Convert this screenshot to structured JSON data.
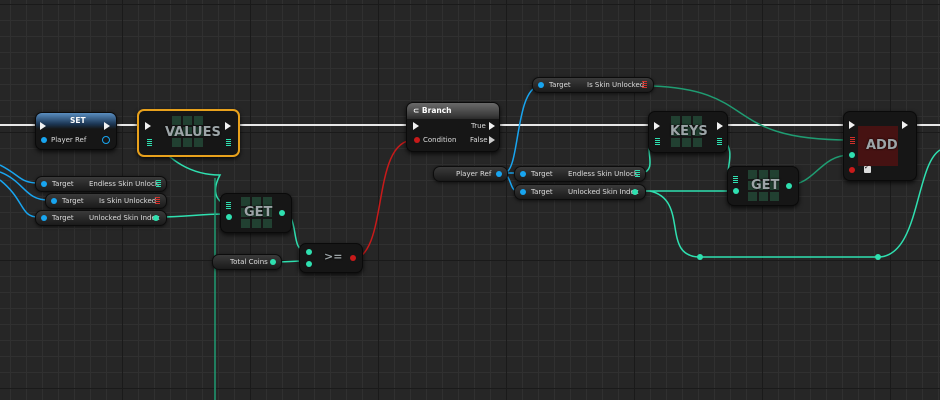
{
  "nodes": {
    "set": {
      "title": "SET",
      "pin_player_ref": "Player Ref"
    },
    "values": {
      "title": "VALUES"
    },
    "targets_left": [
      {
        "target": "Target",
        "value": "Endless Skin Unlock"
      },
      {
        "target": "Target",
        "value": "Is Skin Unlocked"
      },
      {
        "target": "Target",
        "value": "Unlocked Skin Index"
      }
    ],
    "get_left": {
      "title": "GET"
    },
    "total_coins": {
      "label": "Total Coins"
    },
    "compare": {
      "title": ">="
    },
    "branch": {
      "title": "Branch",
      "condition": "Condition",
      "true_label": "True",
      "false_label": "False"
    },
    "player_ref": {
      "label": "Player Ref"
    },
    "is_skin_unlocked_top": {
      "target": "Target",
      "value": "Is Skin Unlocked"
    },
    "targets_mid": [
      {
        "target": "Target",
        "value": "Endless Skin Unlock"
      },
      {
        "target": "Target",
        "value": "Unlocked Skin Index"
      }
    ],
    "keys": {
      "title": "KEYS"
    },
    "get_right": {
      "title": "GET"
    },
    "add": {
      "title": "ADD"
    }
  },
  "colors": {
    "exec": "#f2f2f2",
    "object": "#18a5f0",
    "integer": "#2fe0b0",
    "boolean": "#c81a1a",
    "selected": "#e8a11c"
  }
}
